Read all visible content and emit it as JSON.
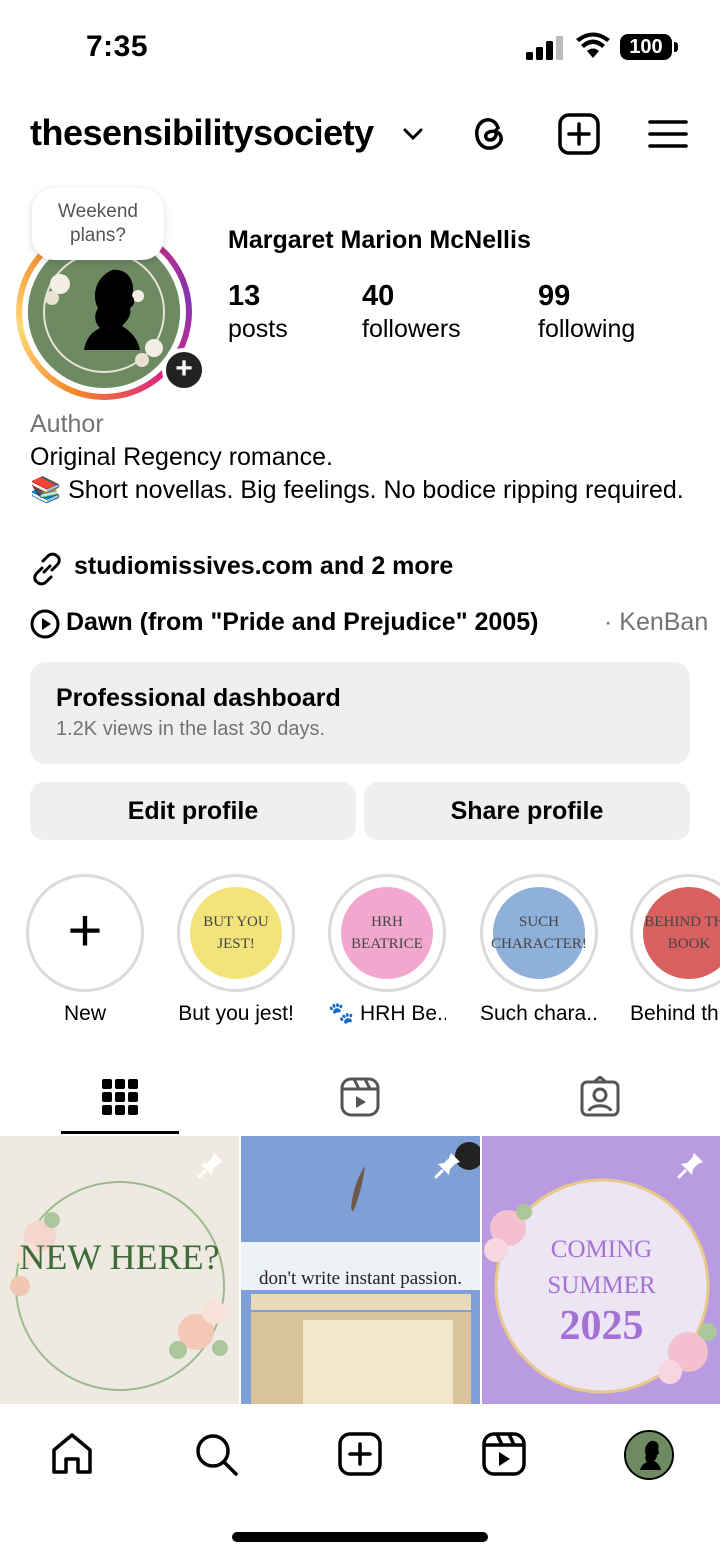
{
  "status_bar": {
    "time": "7:35",
    "battery": "100"
  },
  "header": {
    "username": "thesensibilitysociety"
  },
  "profile": {
    "note": "Weekend plans?",
    "display_name": "Margaret Marion McNellis",
    "stats": [
      {
        "value": "13",
        "label": "posts"
      },
      {
        "value": "40",
        "label": "followers"
      },
      {
        "value": "99",
        "label": "following"
      }
    ],
    "category": "Author",
    "bio_line1": "Original Regency romance.",
    "bio_line2": "📚 Short novellas. Big feelings. No bodice ripping required.",
    "link_text": "studiomissives.com and 2 more",
    "music_title": "Dawn (from \"Pride and Prejudice\" 2005)",
    "music_artist": "· KenBan"
  },
  "dashboard": {
    "title": "Professional dashboard",
    "subtitle": "1.2K views in the last 30 days."
  },
  "buttons": {
    "edit": "Edit profile",
    "share": "Share profile"
  },
  "highlights": [
    {
      "label": "New",
      "cover_text": ""
    },
    {
      "label": "But you jest!",
      "cover_text": "BUT YOU JEST!",
      "color": "#f2e37a"
    },
    {
      "label": "🐾 HRH Be...",
      "cover_text": "HRH BEATRICE",
      "color": "#f2a7cf"
    },
    {
      "label": "Such chara...",
      "cover_text": "SUCH CHARACTER!",
      "color": "#8fb0d9"
    },
    {
      "label": "Behind th",
      "cover_text": "BEHIND THE BOOK",
      "color": "#d96060"
    }
  ],
  "posts": [
    {
      "text": "NEW HERE?"
    },
    {
      "text": "don't write instant passion."
    },
    {
      "text_line1": "COMING",
      "text_line2": "SUMMER",
      "text_line3": "2025"
    }
  ],
  "colors": {
    "accent_bg": "#efefef",
    "secondary_text": "#737373",
    "avatar_green": "#6d8a63"
  }
}
